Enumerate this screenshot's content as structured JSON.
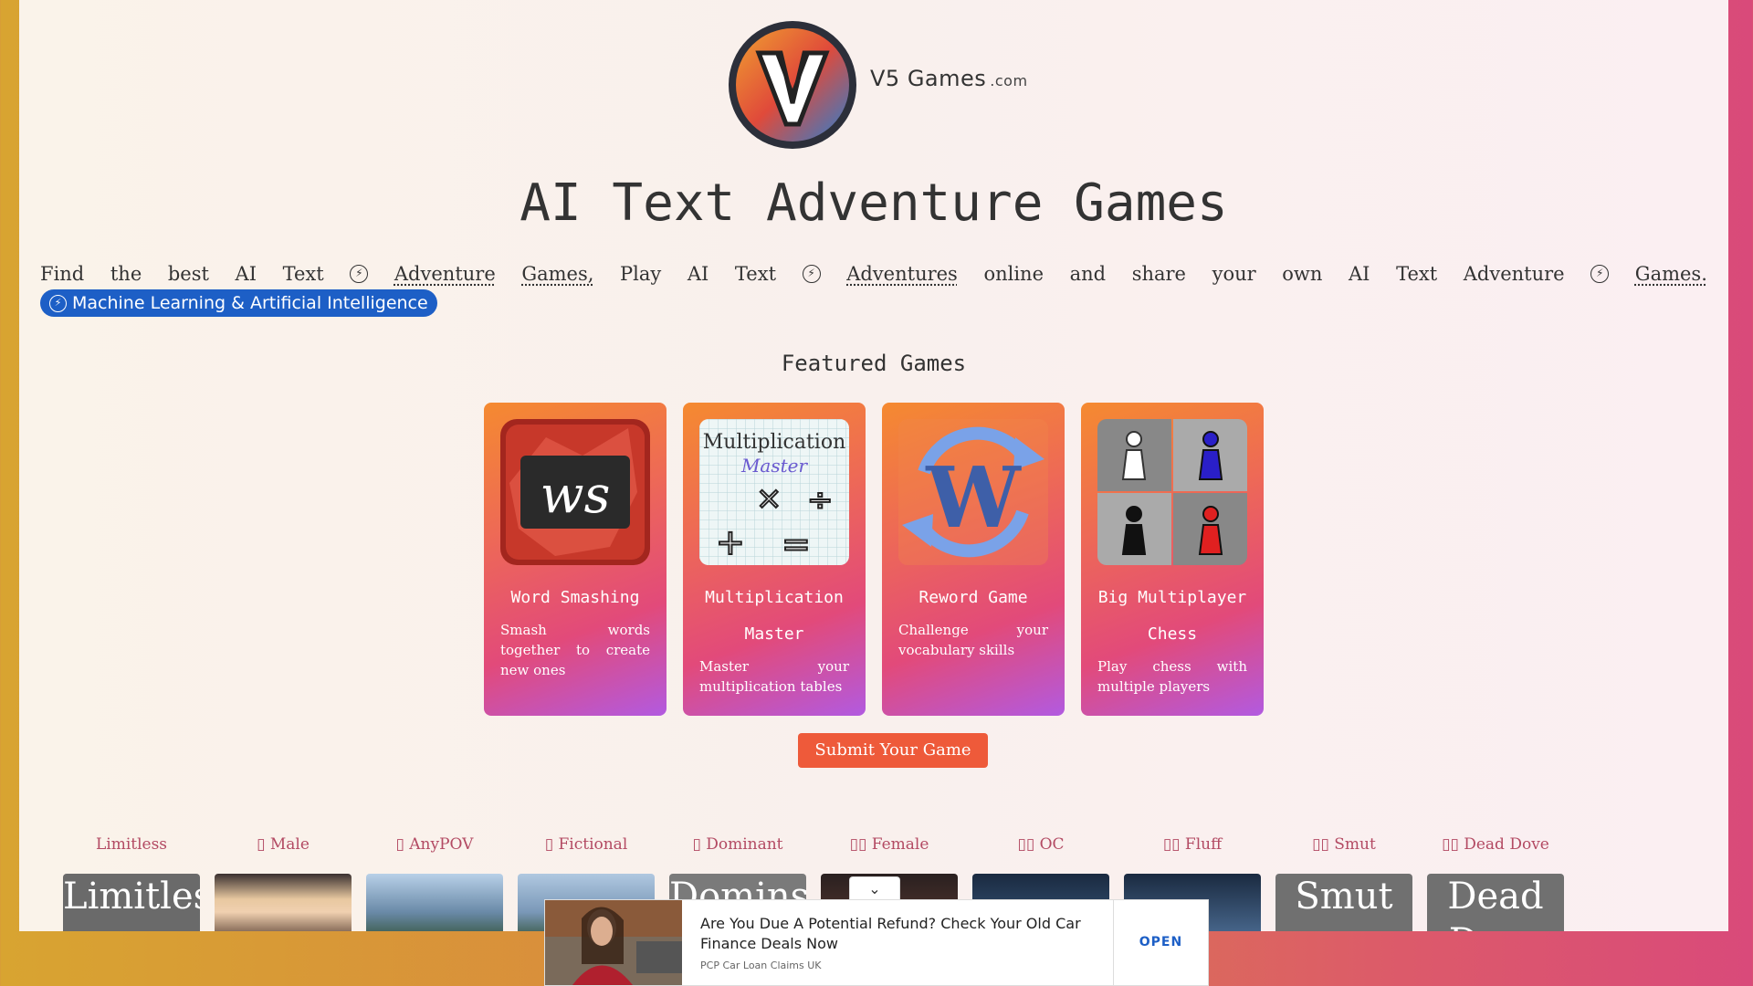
{
  "site": {
    "name": "V5 Games",
    "tld": ".com"
  },
  "title": "AI Text Adventure Games",
  "intro_words": [
    "Find",
    "the",
    "best",
    "AI",
    "Text",
    "⚡",
    "Adventure",
    "Games,",
    "Play",
    "AI",
    "Text",
    "⚡",
    "Adventures",
    "online",
    "and",
    "share",
    "your",
    "own",
    "AI",
    "Text",
    "Adventure",
    "⚡",
    "Games."
  ],
  "ml_badge": "Machine Learning & Artificial Intelligence",
  "featured_heading": "Featured Games",
  "games": [
    {
      "title": "Word Smashing",
      "desc": "Smash words together to create new ones",
      "icon": "ws-logo-icon"
    },
    {
      "title": "Multiplication Master",
      "desc": "Master your multiplication tables",
      "icon": "multiplication-master-icon"
    },
    {
      "title": "Reword Game",
      "desc": "Challenge your vocabulary skills",
      "icon": "reword-w-icon"
    },
    {
      "title": "Big Multiplayer Chess",
      "desc": "Play chess with multiple players",
      "icon": "chess-pawns-icon"
    }
  ],
  "submit_label": "Submit Your Game",
  "categories": [
    {
      "label": "Limitless",
      "thumb_text": "Limitless"
    },
    {
      "label": "▯ Male",
      "thumb_text": ""
    },
    {
      "label": "▯ AnyPOV",
      "thumb_text": ""
    },
    {
      "label": "▯ Fictional",
      "thumb_text": ""
    },
    {
      "label": "▯ Dominant",
      "thumb_text": "Domins"
    },
    {
      "label": "▯▯ Female",
      "thumb_text": ""
    },
    {
      "label": "▯▯ OC",
      "thumb_text": ""
    },
    {
      "label": "▯▯ Fluff",
      "thumb_text": ""
    },
    {
      "label": "▯▯ Smut",
      "thumb_text": "Smut"
    },
    {
      "label": "▯▯ Dead Dove",
      "thumb_text": "Dead Dove"
    }
  ],
  "ad": {
    "headline": "Are You Due A Potential Refund? Check Your Old Car Finance Deals Now",
    "source": "PCP Car Loan Claims UK",
    "cta": "OPEN"
  }
}
